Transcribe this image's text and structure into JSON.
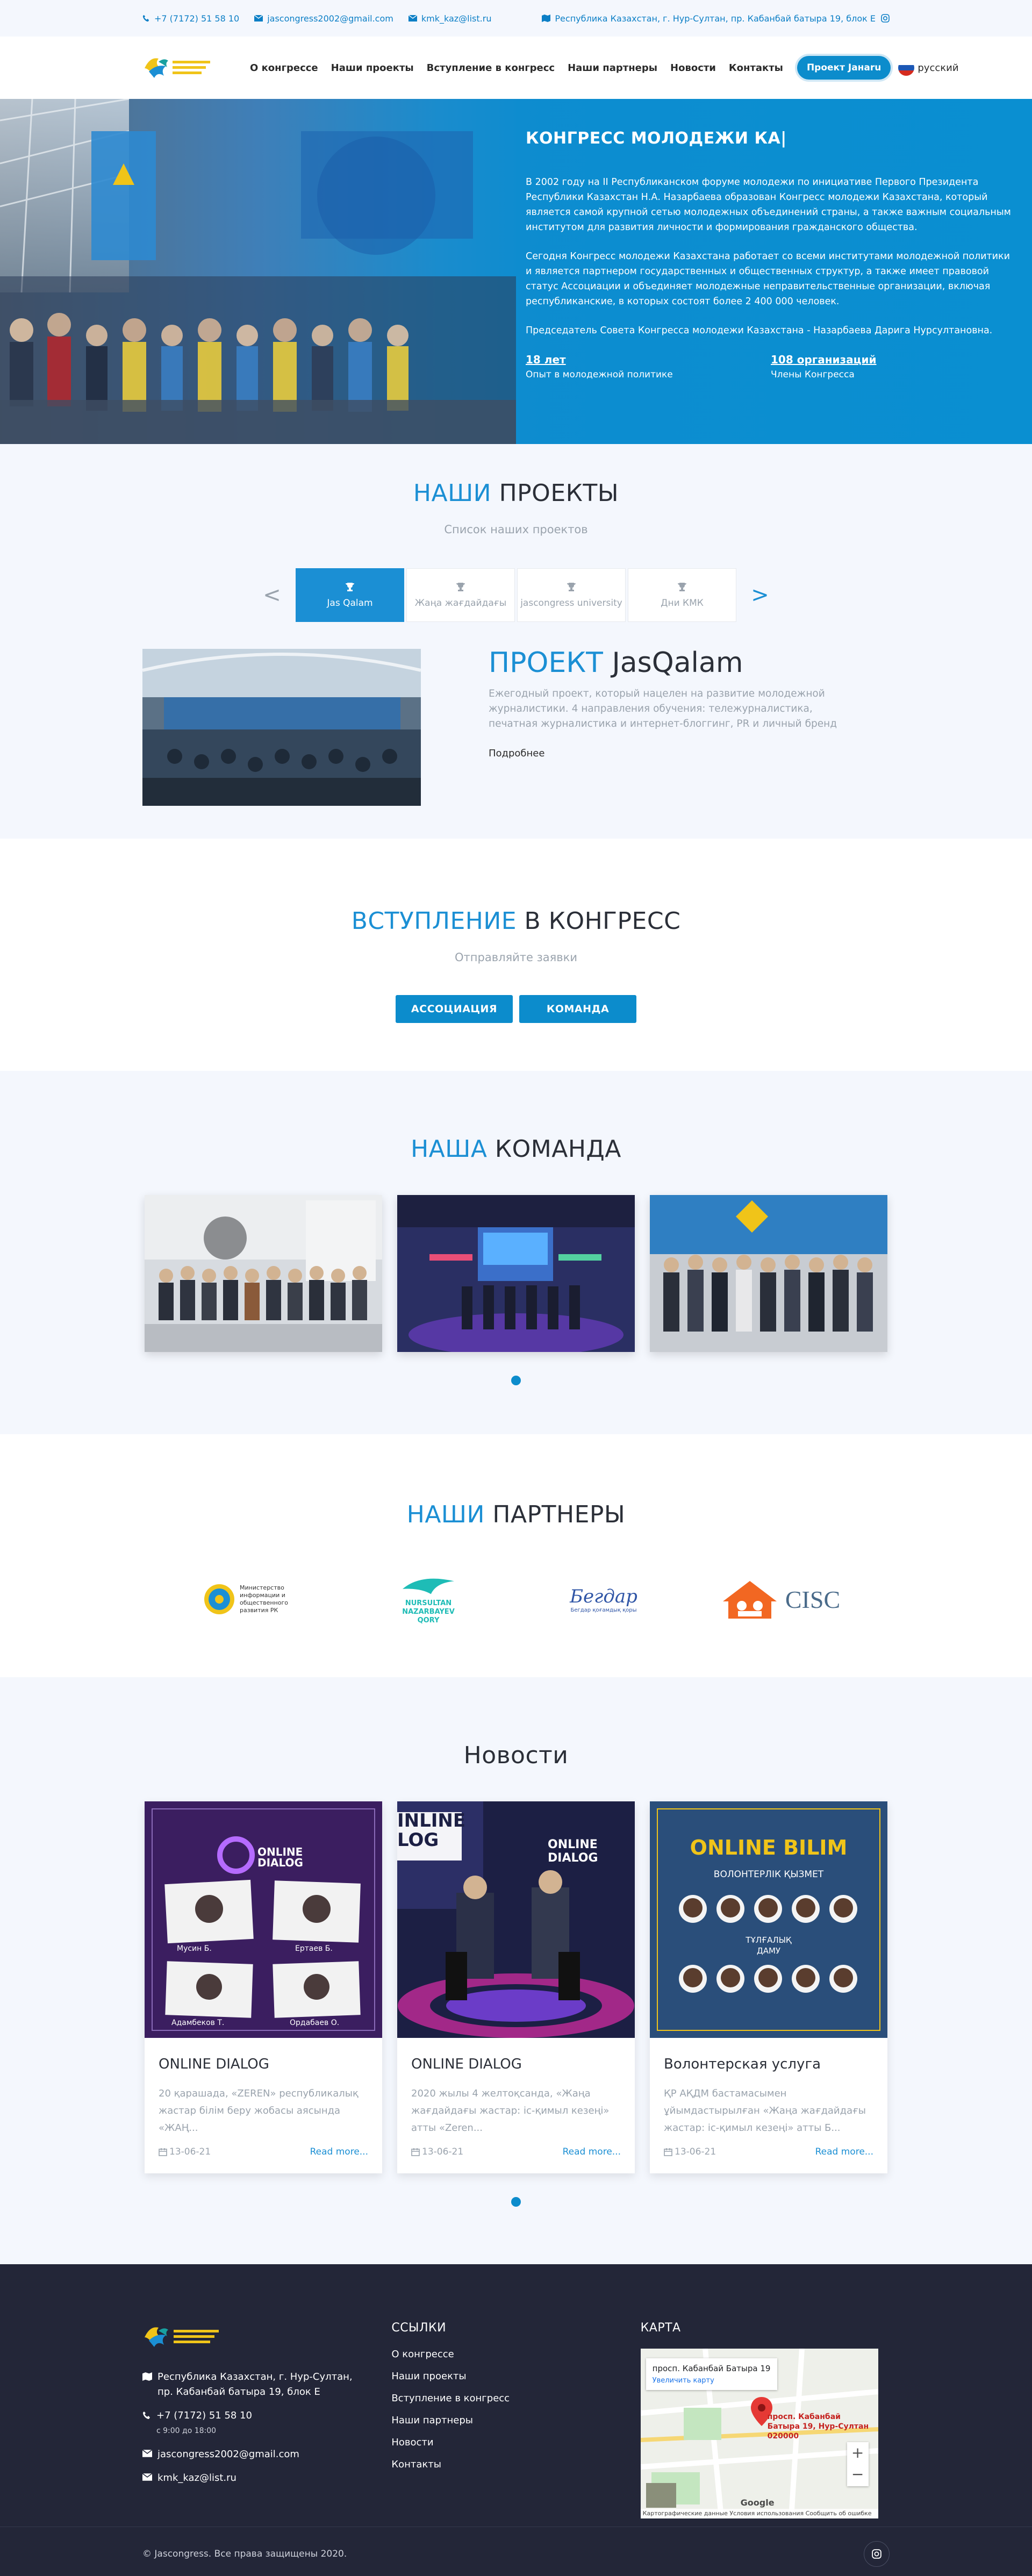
{
  "topbar": {
    "phone": "+7 (7172) 51 58 10",
    "email1": "jascongress2002@gmail.com",
    "email2": "kmk_kaz@list.ru",
    "address": "Республика Казахстан, г. Нур-Султан, пр. Кабанбай батыра 19, блок Е"
  },
  "nav": {
    "items": [
      "О конгрессе",
      "Наши проекты",
      "Вступление в конгресс",
      "Наши партнеры",
      "Новости",
      "Контакты"
    ],
    "project_btn": "Проект Jaнaru",
    "lang": "русский"
  },
  "hero": {
    "title": "КОНГРЕСС МОЛОДЕЖИ КА|",
    "p1": "В 2002 году на II Республиканском форуме молодежи по инициативе Первого Президента Республики Казахстан Н.А. Назарбаева образован Конгресс молодежи Казахстана, который является самой крупной сетью молодежных объединений страны, а также важным социальным институтом для развития личности и формирования гражданского общества.",
    "p2": "Сегодня Конгресс молодежи Казахстана работает со всеми институтами молодежной политики и является партнером государственных и общественных структур, а также имеет правовой статус Ассоциации и объединяет молодежные неправительственные организации, включая республиканские, в которых состоят более 2 400 000 человек.",
    "p3": "Председатель Совета Конгресса молодежи Казахстана - Назарбаева Дарига Нурсултановна.",
    "stats": [
      {
        "value": "18 лет",
        "label": "Опыт в молодежной политике"
      },
      {
        "value": "108 организаций",
        "label": "Члены Конгресса"
      }
    ]
  },
  "projects": {
    "title_accent": "НАШИ",
    "title_rest": " ПРОЕКТЫ",
    "subtitle": "Список наших проектов",
    "prev": "<",
    "next": ">",
    "tabs": [
      "Jas Qalam",
      "Жаңа жағдайдағы",
      "jascongress university",
      "Дни КМК"
    ],
    "active_title_accent": "ПРОЕКТ",
    "active_title_rest": " JasQalam",
    "active_desc": "Ежегодный проект, который нацелен на развитие молодежной журналистики. 4 направления обучения: тележурналистика, печатная журналистика и интернет-блоггинг, PR и личный бренд",
    "more": "Подробнее"
  },
  "join": {
    "title_accent": "ВСТУПЛЕНИЕ",
    "title_rest": " В КОНГРЕСС",
    "subtitle": "Отправляйте заявки",
    "btn1": "АССОЦИАЦИЯ",
    "btn2": "КОМАНДА"
  },
  "team": {
    "title_accent": "НАША",
    "title_rest": " КОМАНДА"
  },
  "partners": {
    "title_accent": "НАШИ",
    "title_rest": " ПАРТНЕРЫ",
    "p1_text": "Министерство информации и общественного развития РК",
    "p2_line1": "NURSULTAN",
    "p2_line2": "NAZARBAYEV",
    "p2_line3": "QORY",
    "p3_text": "Бегдар",
    "p3_small": "Бегдар қоғамдық қоры",
    "p4_text": "CISC"
  },
  "news": {
    "title": "Новости",
    "cards": [
      {
        "title": "ONLINE DIALOG",
        "text": "20 қарашада, «ZEREN» республикалық жастар білім беру жобасы аясында «ЖАҢ...",
        "date": "13-06-21",
        "more": "Read more..."
      },
      {
        "title": "ONLINE DIALOG",
        "text": "2020 жылы 4 желтоқсанда, «Жаңа жағдайдағы жастар: іс-қимыл кезеңі» атты «Zeren...",
        "date": "13-06-21",
        "more": "Read more..."
      },
      {
        "title": "Волонтерская услуга",
        "text": "ҚР АҚДМ бастамасымен ұйымдастырылған «Жаңа жағдайдағы жастар: іс-қимыл кезеңі» атты Б...",
        "date": "13-06-21",
        "more": "Read more..."
      }
    ],
    "img1_heading": "ONLINE DIALOG",
    "img1_names": [
      "Мусин Б.",
      "Ертаев Б.",
      "Адамбеков Т.",
      "Ордабаев О."
    ],
    "img2_text": "ONLINE DIALOG",
    "img3_title": "ONLINE BILIM",
    "img3_sub": "ВОЛОНТЕРЛІК ҚЫЗМЕТ",
    "img3_mid": "ТҰЛҒАЛЫҚ ДАМУ"
  },
  "footer": {
    "address": "Республика Казахстан, г. Нур-Султан, пр. Кабанбай батыра 19, блок Е",
    "phone": "+7 (7172) 51 58 10",
    "hours": "с 9:00 до 18:00",
    "email1": "jascongress2002@gmail.com",
    "email2": "kmk_kaz@list.ru",
    "links_title": "ССЫЛКИ",
    "links": [
      "О конгрессе",
      "Наши проекты",
      "Вступление в конгресс",
      "Наши партнеры",
      "Новости",
      "Контакты"
    ],
    "map_title": "КАРТА",
    "map_place": "просп. Кабанбай Батыра 19",
    "map_enlarge": "Увеличить карту",
    "map_pin": "просп. Кабанбай Батыра 19, Нур-Султан 020000",
    "map_google": "Google",
    "map_bottom": "Картографические данные  Условия использования  Сообщить об ошибке на карте",
    "copyright": "© Jascongress. Все права защищены 2020."
  },
  "colors": {
    "accent": "#1b8fd4",
    "button": "#0c8ccc",
    "light_bg": "#f4f7fd",
    "footer_bg": "#232638"
  }
}
